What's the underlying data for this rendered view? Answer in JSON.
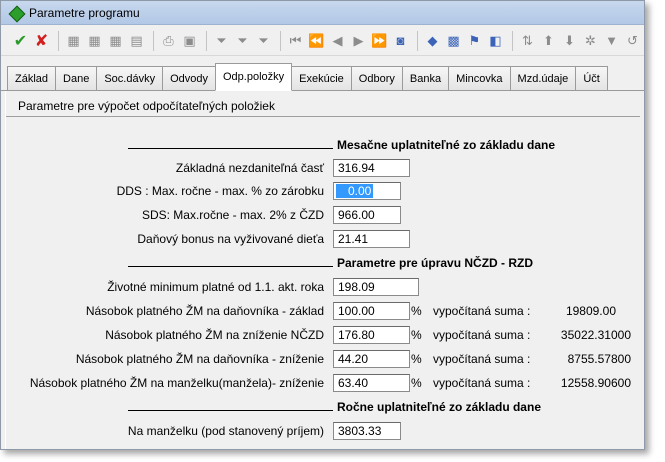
{
  "window": {
    "title": "Parametre programu"
  },
  "toolbar": {
    "buttons": [
      {
        "name": "confirm-icon",
        "glyph": "✔"
      },
      {
        "name": "cancel-icon",
        "glyph": "✘"
      },
      {
        "name": "grid-icon",
        "glyph": "▦"
      },
      {
        "name": "grid-add-icon",
        "glyph": "▦"
      },
      {
        "name": "grid-edit-icon",
        "glyph": "▦"
      },
      {
        "name": "grid-delete-icon",
        "glyph": "▤"
      },
      {
        "name": "print-icon",
        "glyph": "⎙"
      },
      {
        "name": "preview-icon",
        "glyph": "▣"
      },
      {
        "name": "filter-icon",
        "glyph": "⏷"
      },
      {
        "name": "filter-add-icon",
        "glyph": "⏷"
      },
      {
        "name": "filter-remove-icon",
        "glyph": "⏷"
      },
      {
        "name": "first-record-icon",
        "glyph": "⏮"
      },
      {
        "name": "prev-page-icon",
        "glyph": "⏪"
      },
      {
        "name": "prev-record-icon",
        "glyph": "◀"
      },
      {
        "name": "next-record-icon",
        "glyph": "▶"
      },
      {
        "name": "next-page-icon",
        "glyph": "⏩"
      },
      {
        "name": "binoculars-icon",
        "glyph": "◙"
      },
      {
        "name": "database-icon",
        "glyph": "◆"
      },
      {
        "name": "calculator-icon",
        "glyph": "▩"
      },
      {
        "name": "flag-icon",
        "glyph": "⚑"
      },
      {
        "name": "windows-icon",
        "glyph": "◧"
      },
      {
        "name": "sort-icon",
        "glyph": "⇅"
      },
      {
        "name": "arrow-up-icon",
        "glyph": "⬆"
      },
      {
        "name": "arrow-down-icon",
        "glyph": "⬇"
      },
      {
        "name": "settings-icon",
        "glyph": "✲"
      },
      {
        "name": "pin-icon",
        "glyph": "▼"
      },
      {
        "name": "refresh-icon",
        "glyph": "↺"
      }
    ]
  },
  "tabs": [
    {
      "label": "Základ",
      "active": false
    },
    {
      "label": "Dane",
      "active": false
    },
    {
      "label": "Soc.dávky",
      "active": false
    },
    {
      "label": "Odvody",
      "active": false
    },
    {
      "label": "Odp.položky",
      "active": true
    },
    {
      "label": "Exekúcie",
      "active": false
    },
    {
      "label": "Odbory",
      "active": false
    },
    {
      "label": "Banka",
      "active": false
    },
    {
      "label": "Mincovka",
      "active": false
    },
    {
      "label": "Mzd.údaje",
      "active": false
    },
    {
      "label": "Účt",
      "active": false
    }
  ],
  "panel": {
    "header": "Parametre pre výpočet odpočítateľných položiek",
    "sections": {
      "monthly": "Mesačne uplatniteľné zo základu dane",
      "adjust": "Parametre pre úpravu NČZD - RZD",
      "yearly": "Ročne uplatniteľné zo základu dane"
    },
    "fields": {
      "basic_allowance": {
        "label": "Základná nezdaniteľná časť",
        "value": "316.94"
      },
      "dds": {
        "label": "DDS : Max. ročne - max. % zo zárobku",
        "value": "0.00"
      },
      "sds": {
        "label": "SDS: Max.ročne - max. 2% z ČZD",
        "value": "966.00"
      },
      "child_bonus": {
        "label": "Daňový bonus na vyživované dieťa",
        "value": "21.41"
      },
      "living_min": {
        "label": "Životné minimum platné od 1.1. akt. roka",
        "value": "198.09"
      },
      "mult_taxpayer_base": {
        "label": "Násobok platného ŽM na daňovníka - základ",
        "value": "100.00",
        "pct": "%",
        "calc_label": "vypočítaná suma :",
        "calc_value": "19809.00"
      },
      "mult_nczd_reduce": {
        "label": "Násobok platného ŽM na zníženie NČZD",
        "value": "176.80",
        "pct": "%",
        "calc_label": "vypočítaná suma :",
        "calc_value": "35022.31000"
      },
      "mult_taxpayer_reduce": {
        "label": "Násobok platného ŽM na daňovníka - zníženie",
        "value": "44.20",
        "pct": "%",
        "calc_label": "vypočítaná suma :",
        "calc_value": "8755.57800"
      },
      "mult_spouse_reduce": {
        "label": "Násobok platného ŽM na manželku(manžela)- zníženie",
        "value": "63.40",
        "pct": "%",
        "calc_label": "vypočítaná suma :",
        "calc_value": "12558.90600"
      },
      "spouse": {
        "label": "Na manželku (pod stanovený príjem)",
        "value": "3803.33"
      }
    }
  }
}
